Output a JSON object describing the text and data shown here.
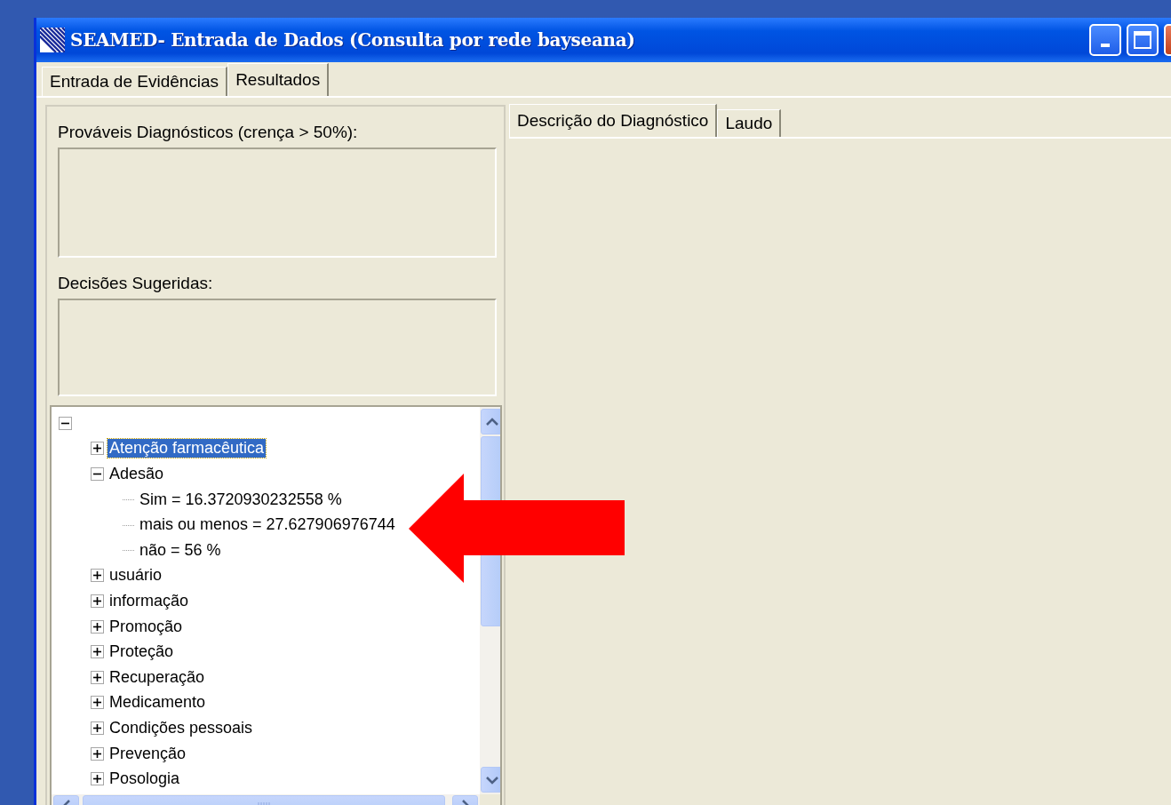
{
  "window": {
    "title": "SEAMED- Entrada de Dados (Consulta por rede bayseana)"
  },
  "tabs": [
    {
      "label": "Entrada de Evidências",
      "selected": false
    },
    {
      "label": "Resultados",
      "selected": true
    }
  ],
  "groups": [
    {
      "label": "Prováveis Diagnósticos (crença > 50%):"
    },
    {
      "label": "Decisões Sugeridas:"
    }
  ],
  "tree": {
    "expanded": true,
    "children": [
      {
        "label": "Atenção farmacêutica",
        "expanded": false,
        "selected": true
      },
      {
        "label": "Adesão",
        "expanded": true,
        "selected": false,
        "children": [
          {
            "label": "Sim = 16.3720930232558 %",
            "selected": false
          },
          {
            "label": "mais ou menos = 27.627906976744",
            "selected": false
          },
          {
            "label": "não = 56 %",
            "selected": false
          }
        ]
      },
      {
        "label": "usuário",
        "expanded": false,
        "selected": false
      },
      {
        "label": "informação",
        "expanded": false,
        "selected": false
      },
      {
        "label": "Promoção",
        "expanded": false,
        "selected": false
      },
      {
        "label": "Proteção",
        "expanded": false,
        "selected": false
      },
      {
        "label": "Recuperação",
        "expanded": false,
        "selected": false
      },
      {
        "label": "Medicamento",
        "expanded": false,
        "selected": false
      },
      {
        "label": "Condições pessoais",
        "expanded": false,
        "selected": false
      },
      {
        "label": "Prevenção",
        "expanded": false,
        "selected": false
      },
      {
        "label": "Posologia",
        "expanded": false,
        "selected": false
      }
    ]
  },
  "detail_tabs": [
    {
      "label": "Descrição do Diagnóstico",
      "selected": true
    },
    {
      "label": "Laudo",
      "selected": false
    }
  ]
}
